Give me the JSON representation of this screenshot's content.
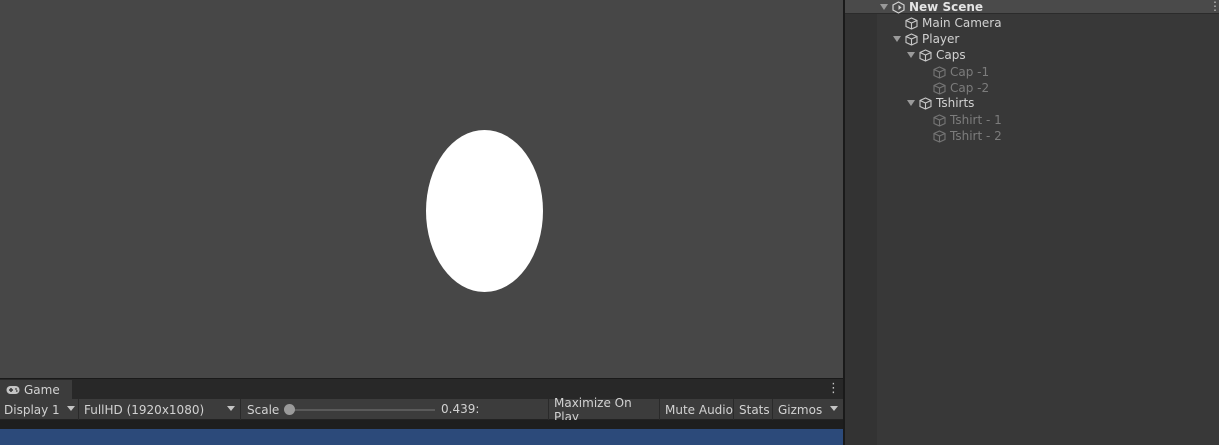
{
  "game": {
    "tab_label": "Game",
    "display": "Display 1",
    "resolution": "FullHD (1920x1080)",
    "scale_label": "Scale",
    "scale_value": "0.439:",
    "maximize_label": "Maximize On Play",
    "mute_label": "Mute Audio",
    "stats_label": "Stats",
    "gizmos_label": "Gizmos"
  },
  "hierarchy": {
    "scene": "New Scene",
    "items": [
      {
        "label": "Main Camera",
        "active": true
      },
      {
        "label": "Player",
        "active": true
      },
      {
        "label": "Caps",
        "active": true
      },
      {
        "label": "Cap -1",
        "active": false
      },
      {
        "label": "Cap -2",
        "active": false
      },
      {
        "label": "Tshirts",
        "active": true
      },
      {
        "label": "Tshirt - 1",
        "active": false
      },
      {
        "label": "Tshirt - 2",
        "active": false
      }
    ]
  },
  "colors": {
    "scene_background": "#474747",
    "ellipse": "#ffffff",
    "game_view": "#2c4a7a"
  },
  "icons": [
    "unity-scene-icon",
    "gameobject-cube-icon",
    "gamepad-icon",
    "kebab-menu-icon",
    "dropdown-arrow-icon"
  ]
}
